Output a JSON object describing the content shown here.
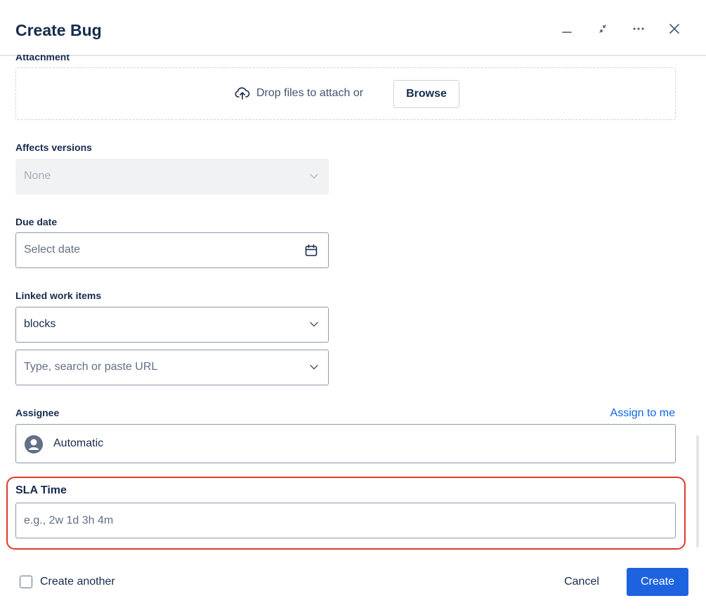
{
  "header": {
    "title": "Create Bug",
    "actions": [
      "minimize-icon",
      "collapse-icon",
      "more-icon",
      "close-icon"
    ]
  },
  "attachment": {
    "label": "Attachment",
    "drop_text": "Drop files to attach or",
    "browse_label": "Browse"
  },
  "affects_versions": {
    "label": "Affects versions",
    "value": "None",
    "disabled": true
  },
  "due_date": {
    "label": "Due date",
    "placeholder": "Select date"
  },
  "linked_work_items": {
    "label": "Linked work items",
    "relation_value": "blocks",
    "search_placeholder": "Type, search or paste URL"
  },
  "assignee": {
    "label": "Assignee",
    "assign_to_me": "Assign to me",
    "value": "Automatic"
  },
  "sla_time": {
    "label": "SLA Time",
    "placeholder": "e.g., 2w 1d 3h 4m"
  },
  "footer": {
    "create_another_label": "Create another",
    "create_another_checked": false,
    "cancel_label": "Cancel",
    "create_label": "Create"
  },
  "colors": {
    "primary": "#1d63e0",
    "link": "#0c66e4",
    "highlight": "#e0392b",
    "text": "#172b4d"
  }
}
